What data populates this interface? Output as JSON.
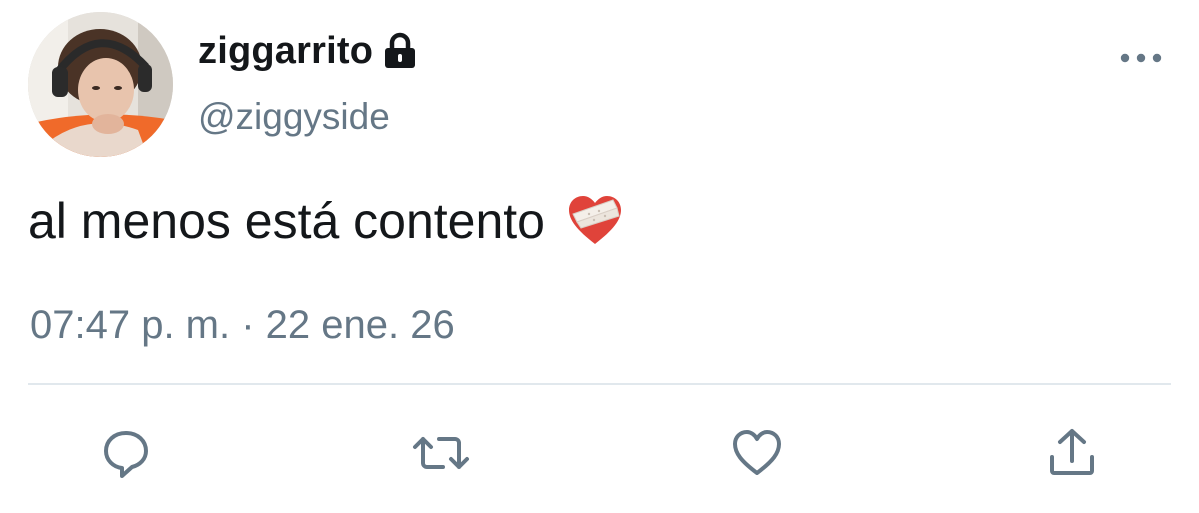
{
  "author": {
    "display_name": "ziggarrito",
    "handle": "@ziggyside",
    "protected_icon": "lock-icon"
  },
  "tweet": {
    "text": "al menos está contento",
    "emoji": "mending-heart-emoji",
    "timestamp": "07:47 p. m. · 22 ene. 26"
  },
  "menu": {
    "icon": "more-horizontal-icon"
  },
  "actions": [
    {
      "name": "reply",
      "icon": "reply-bubble-icon"
    },
    {
      "name": "retweet",
      "icon": "retweet-icon"
    },
    {
      "name": "like",
      "icon": "heart-icon"
    },
    {
      "name": "share",
      "icon": "share-icon"
    }
  ],
  "colors": {
    "text_primary": "#14171a",
    "text_secondary": "#657786",
    "divider": "#e1e8ed",
    "icon": "#657786",
    "emoji_heart": "#e0433a"
  }
}
